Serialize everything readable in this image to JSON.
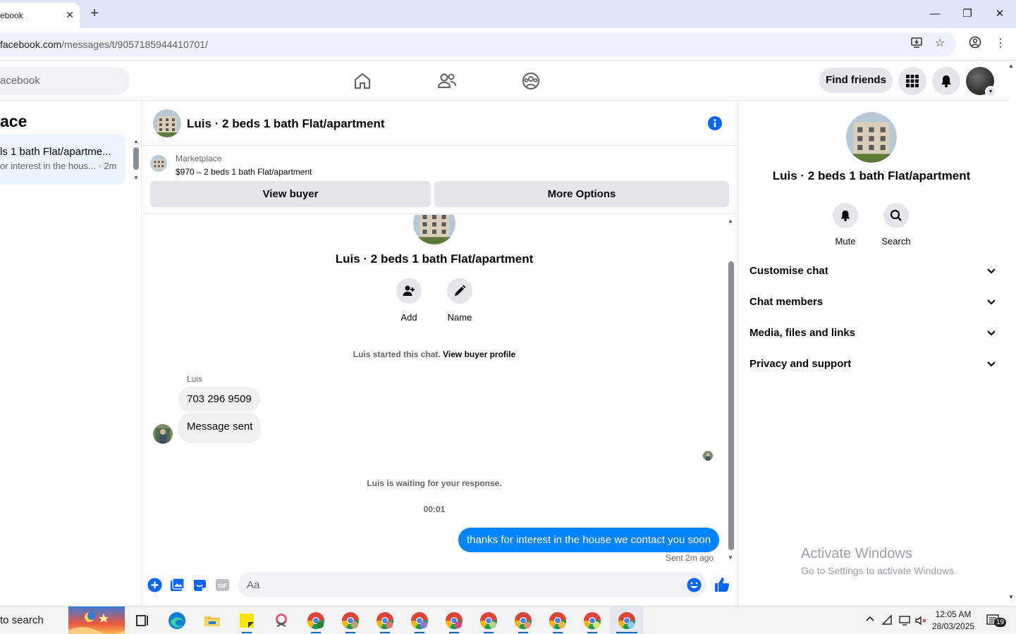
{
  "browser": {
    "tab_title": "ebook",
    "url_host": "facebook.com",
    "url_path": "/messages/t/9057185944410701/"
  },
  "fb_nav": {
    "search_placeholder": "acebook",
    "find_friends": "Find friends"
  },
  "left_panel": {
    "title": "ace",
    "item_title": "ls 1 bath Flat/apartme...",
    "item_preview": "or interest in the hous... · 2m"
  },
  "chat": {
    "header_name": "Luis · 2 beds 1 bath Flat/apartment",
    "marketplace_label": "Marketplace",
    "listing": "$970 – 2 beds 1 bath Flat/apartment",
    "view_buyer": "View buyer",
    "more_options": "More Options",
    "body_name": "Luis · 2 beds 1 bath Flat/apartment",
    "add_label": "Add",
    "name_label": "Name",
    "started_text": "Luis started this chat.",
    "view_buyer_profile": "View buyer profile",
    "sender_name": "Luis",
    "msg1": "703 296 9509",
    "msg2": "Message sent",
    "waiting_text": "Luis is waiting for your response.",
    "time_stamp": "00:01",
    "outgoing": "thanks for interest in the house we contact you soon",
    "sent_status": "Sent 2m ago",
    "input_placeholder": "Aa"
  },
  "right_panel": {
    "name": "Luis · 2 beds 1 bath Flat/apartment",
    "mute": "Mute",
    "search": "Search",
    "sections": [
      "Customise chat",
      "Chat members",
      "Media, files and links",
      "Privacy and support"
    ],
    "activate_title": "Activate Windows",
    "activate_sub": "Go to Settings to activate Windows."
  },
  "taskbar": {
    "search": "to search",
    "time": "12:05 AM",
    "date": "28/03/2025",
    "notifications": "19"
  },
  "colors": {
    "accent": "#0084ff",
    "fb_blue": "#0866ff",
    "bubble_in": "#f0f0f0"
  }
}
